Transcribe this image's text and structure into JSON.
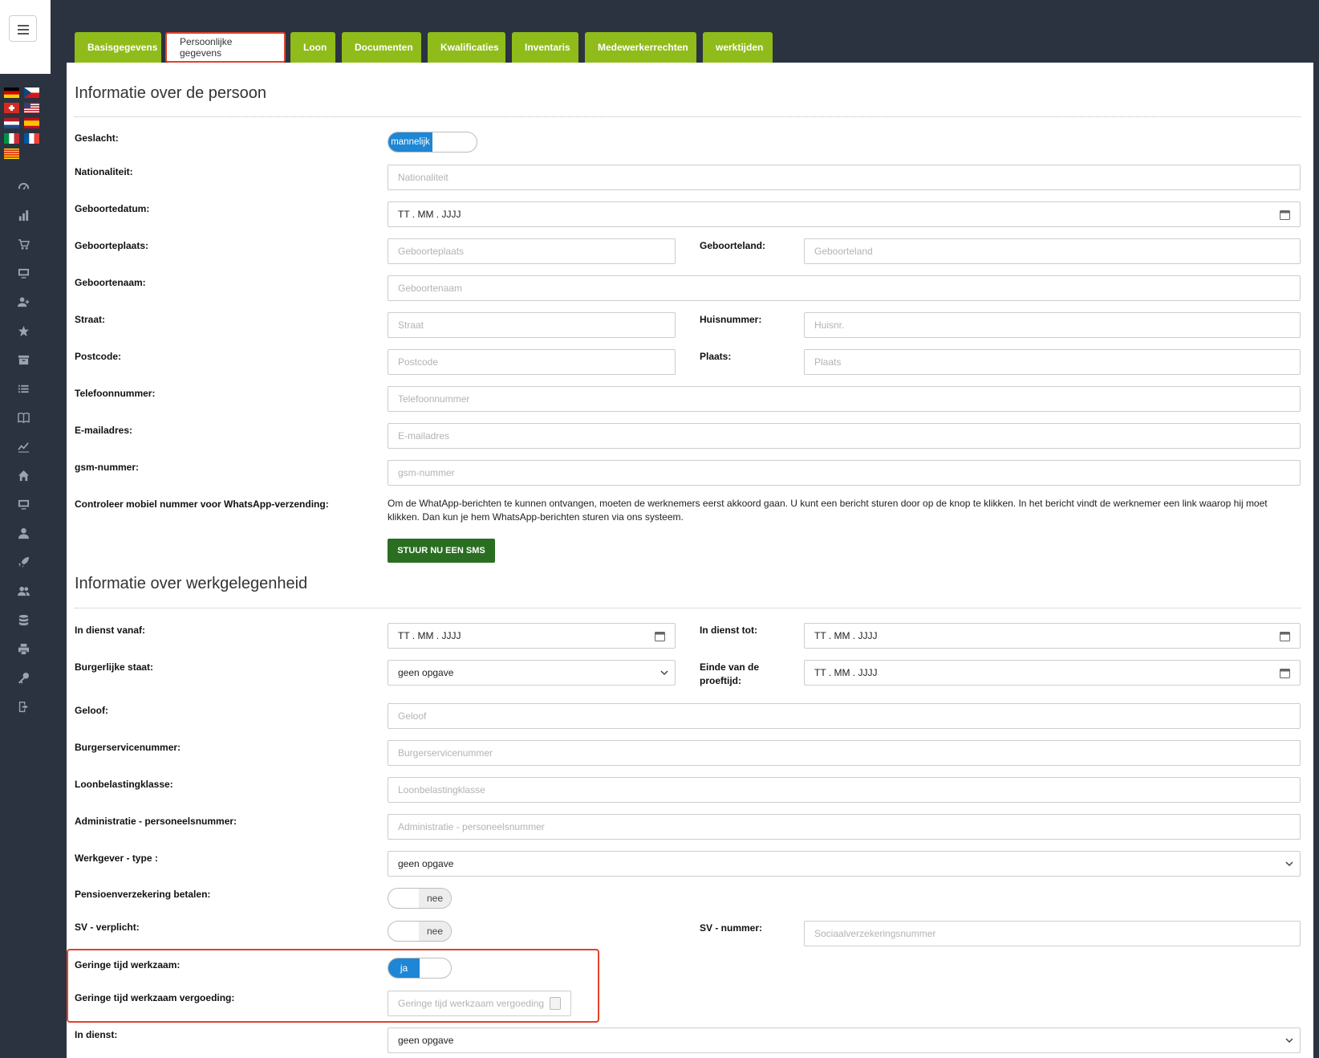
{
  "tabs": [
    "Basisgegevens",
    "Persoonlijke gegevens",
    "Loon",
    "Documenten",
    "Kwalificaties",
    "Inventaris",
    "Medewerkerrechten",
    "werktijden"
  ],
  "active_tab": "Persoonlijke gegevens",
  "section_person": {
    "title": "Informatie over de persoon",
    "gender_label": "Geslacht:",
    "gender_value": "mannelijk",
    "nationality_label": "Nationaliteit:",
    "nationality_placeholder": "Nationaliteit",
    "birthdate_label": "Geboortedatum:",
    "birthdate_value": "TT . MM . JJJJ",
    "birthplace_label": "Geboorteplaats:",
    "birthplace_placeholder": "Geboorteplaats",
    "birthcountry_label": "Geboorteland:",
    "birthcountry_placeholder": "Geboorteland",
    "birthname_label": "Geboortenaam:",
    "birthname_placeholder": "Geboortenaam",
    "street_label": "Straat:",
    "street_placeholder": "Straat",
    "housenr_label": "Huisnummer:",
    "housenr_placeholder": "Huisnr.",
    "postcode_label": "Postcode:",
    "postcode_placeholder": "Postcode",
    "city_label": "Plaats:",
    "city_placeholder": "Plaats",
    "phone_label": "Telefoonnummer:",
    "phone_placeholder": "Telefoonnummer",
    "email_label": "E-mailadres:",
    "email_placeholder": "E-mailadres",
    "gsm_label": "gsm-nummer:",
    "gsm_placeholder": "gsm-nummer",
    "whatsapp_label": "Controleer mobiel nummer voor WhatsApp-verzending:",
    "whatsapp_text": "Om de WhatApp-berichten te kunnen ontvangen, moeten de werknemers eerst akkoord gaan. U kunt een bericht sturen door op de knop te klikken. In het bericht vindt de werknemer een link waarop hij moet klikken. Dan kun je hem WhatsApp-berichten sturen via ons systeem.",
    "sms_button": "STUUR NU EEN SMS"
  },
  "section_employment": {
    "title": "Informatie over werkgelegenheid",
    "start_label": "In dienst vanaf:",
    "start_value": "TT . MM . JJJJ",
    "end_label": "In dienst tot:",
    "end_value": "TT . MM . JJJJ",
    "marital_label": "Burgerlijke staat:",
    "marital_value": "geen opgave",
    "probation_label": "Einde van de proeftijd:",
    "probation_value": "TT . MM . JJJJ",
    "religion_label": "Geloof:",
    "religion_placeholder": "Geloof",
    "bsn_label": "Burgerservicenummer:",
    "bsn_placeholder": "Burgerservicenummer",
    "taxclass_label": "Loonbelastingklasse:",
    "taxclass_placeholder": "Loonbelastingklasse",
    "admin_label": "Administratie - personeelsnummer:",
    "admin_placeholder": "Administratie - personeelsnummer",
    "employer_type_label": "Werkgever - type :",
    "employer_type_value": "geen opgave",
    "pension_label": "Pensioenverzekering betalen:",
    "pension_value": "nee",
    "sv_label": "SV - verplicht:",
    "sv_value": "nee",
    "sv_number_label": "SV - nummer:",
    "sv_number_placeholder": "Sociaalverzekeringsnummer",
    "lowtime_label": "Geringe tijd werkzaam:",
    "lowtime_value": "ja",
    "lowtime_comp_label": "Geringe tijd werkzaam vergoeding:",
    "lowtime_comp_placeholder": "Geringe tijd werkzaam vergoeding",
    "in_service_label": "In dienst:",
    "in_service_value": "geen opgave"
  },
  "icons": [
    "speedometer-icon",
    "bar-chart-icon",
    "cart-icon",
    "monitor-icon",
    "add-user-icon",
    "star-icon",
    "archive-icon",
    "list-icon",
    "book-icon",
    "trend-icon",
    "home-icon",
    "monitor-icon",
    "user-icon",
    "rocket-icon",
    "users-icon",
    "database-icon",
    "printer-icon",
    "key-icon",
    "logout-icon"
  ],
  "colors": {
    "tab_green": "#8fbc1a",
    "toggle_blue": "#1e86d5",
    "sms_button": "#2a6e22",
    "highlight_red": "#e0432b"
  }
}
